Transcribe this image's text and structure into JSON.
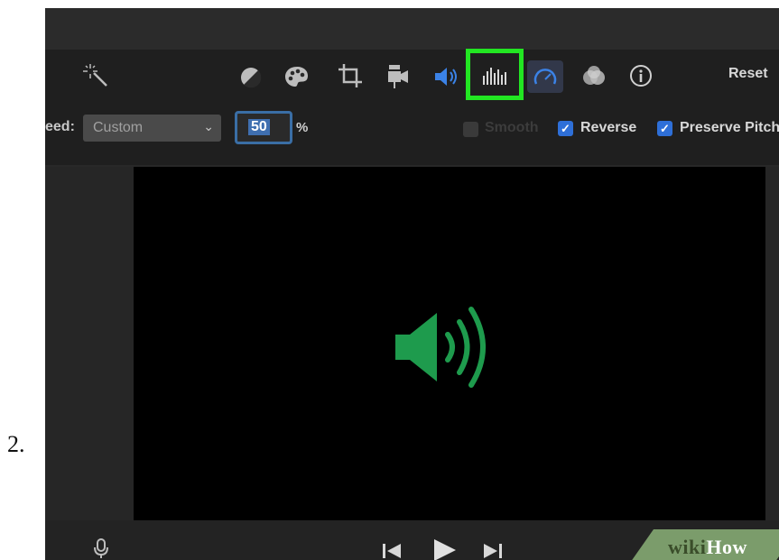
{
  "step": {
    "number": "2."
  },
  "toolbar": {
    "icons": [
      "magic-wand-icon",
      "color-balance-icon",
      "palette-icon",
      "crop-icon",
      "camera-icon",
      "volume-icon",
      "equalizer-icon",
      "speedometer-icon",
      "filters-icon",
      "info-icon"
    ],
    "reset_label": "Reset",
    "highlight_color": "#22e622"
  },
  "speed": {
    "label": "eed:",
    "select_value": "Custom",
    "percent_value": "50",
    "percent_sign": "%",
    "options": [
      {
        "label": "Smooth",
        "checked": false,
        "enabled": false
      },
      {
        "label": "Reverse",
        "checked": true,
        "enabled": true
      },
      {
        "label": "Preserve Pitch",
        "checked": true,
        "enabled": true
      }
    ]
  },
  "viewer": {
    "overlay_icon": "speaker-icon",
    "overlay_color": "#1e9b4d"
  },
  "playback": {
    "icons": [
      "microphone-icon",
      "skip-back-icon",
      "play-icon",
      "skip-forward-icon"
    ]
  },
  "watermark": {
    "part1": "wiki",
    "part2": "How"
  },
  "accent": "#2e6fd8"
}
